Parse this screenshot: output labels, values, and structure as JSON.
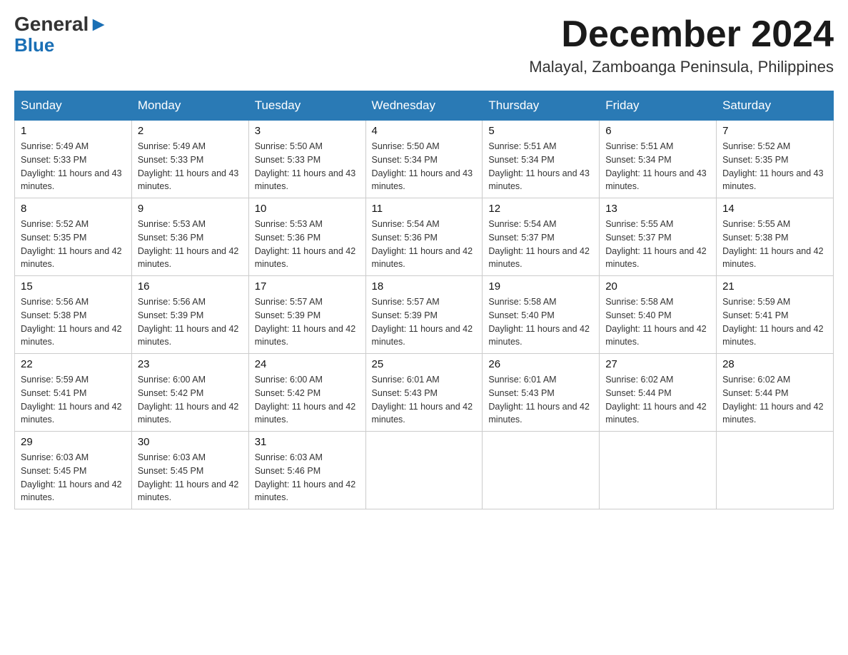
{
  "header": {
    "logo_general": "General",
    "logo_blue": "Blue",
    "month_title": "December 2024",
    "location": "Malayal, Zamboanga Peninsula, Philippines"
  },
  "weekdays": [
    "Sunday",
    "Monday",
    "Tuesday",
    "Wednesday",
    "Thursday",
    "Friday",
    "Saturday"
  ],
  "weeks": [
    [
      {
        "day": "1",
        "sunrise": "5:49 AM",
        "sunset": "5:33 PM",
        "daylight": "11 hours and 43 minutes."
      },
      {
        "day": "2",
        "sunrise": "5:49 AM",
        "sunset": "5:33 PM",
        "daylight": "11 hours and 43 minutes."
      },
      {
        "day": "3",
        "sunrise": "5:50 AM",
        "sunset": "5:33 PM",
        "daylight": "11 hours and 43 minutes."
      },
      {
        "day": "4",
        "sunrise": "5:50 AM",
        "sunset": "5:34 PM",
        "daylight": "11 hours and 43 minutes."
      },
      {
        "day": "5",
        "sunrise": "5:51 AM",
        "sunset": "5:34 PM",
        "daylight": "11 hours and 43 minutes."
      },
      {
        "day": "6",
        "sunrise": "5:51 AM",
        "sunset": "5:34 PM",
        "daylight": "11 hours and 43 minutes."
      },
      {
        "day": "7",
        "sunrise": "5:52 AM",
        "sunset": "5:35 PM",
        "daylight": "11 hours and 43 minutes."
      }
    ],
    [
      {
        "day": "8",
        "sunrise": "5:52 AM",
        "sunset": "5:35 PM",
        "daylight": "11 hours and 42 minutes."
      },
      {
        "day": "9",
        "sunrise": "5:53 AM",
        "sunset": "5:36 PM",
        "daylight": "11 hours and 42 minutes."
      },
      {
        "day": "10",
        "sunrise": "5:53 AM",
        "sunset": "5:36 PM",
        "daylight": "11 hours and 42 minutes."
      },
      {
        "day": "11",
        "sunrise": "5:54 AM",
        "sunset": "5:36 PM",
        "daylight": "11 hours and 42 minutes."
      },
      {
        "day": "12",
        "sunrise": "5:54 AM",
        "sunset": "5:37 PM",
        "daylight": "11 hours and 42 minutes."
      },
      {
        "day": "13",
        "sunrise": "5:55 AM",
        "sunset": "5:37 PM",
        "daylight": "11 hours and 42 minutes."
      },
      {
        "day": "14",
        "sunrise": "5:55 AM",
        "sunset": "5:38 PM",
        "daylight": "11 hours and 42 minutes."
      }
    ],
    [
      {
        "day": "15",
        "sunrise": "5:56 AM",
        "sunset": "5:38 PM",
        "daylight": "11 hours and 42 minutes."
      },
      {
        "day": "16",
        "sunrise": "5:56 AM",
        "sunset": "5:39 PM",
        "daylight": "11 hours and 42 minutes."
      },
      {
        "day": "17",
        "sunrise": "5:57 AM",
        "sunset": "5:39 PM",
        "daylight": "11 hours and 42 minutes."
      },
      {
        "day": "18",
        "sunrise": "5:57 AM",
        "sunset": "5:39 PM",
        "daylight": "11 hours and 42 minutes."
      },
      {
        "day": "19",
        "sunrise": "5:58 AM",
        "sunset": "5:40 PM",
        "daylight": "11 hours and 42 minutes."
      },
      {
        "day": "20",
        "sunrise": "5:58 AM",
        "sunset": "5:40 PM",
        "daylight": "11 hours and 42 minutes."
      },
      {
        "day": "21",
        "sunrise": "5:59 AM",
        "sunset": "5:41 PM",
        "daylight": "11 hours and 42 minutes."
      }
    ],
    [
      {
        "day": "22",
        "sunrise": "5:59 AM",
        "sunset": "5:41 PM",
        "daylight": "11 hours and 42 minutes."
      },
      {
        "day": "23",
        "sunrise": "6:00 AM",
        "sunset": "5:42 PM",
        "daylight": "11 hours and 42 minutes."
      },
      {
        "day": "24",
        "sunrise": "6:00 AM",
        "sunset": "5:42 PM",
        "daylight": "11 hours and 42 minutes."
      },
      {
        "day": "25",
        "sunrise": "6:01 AM",
        "sunset": "5:43 PM",
        "daylight": "11 hours and 42 minutes."
      },
      {
        "day": "26",
        "sunrise": "6:01 AM",
        "sunset": "5:43 PM",
        "daylight": "11 hours and 42 minutes."
      },
      {
        "day": "27",
        "sunrise": "6:02 AM",
        "sunset": "5:44 PM",
        "daylight": "11 hours and 42 minutes."
      },
      {
        "day": "28",
        "sunrise": "6:02 AM",
        "sunset": "5:44 PM",
        "daylight": "11 hours and 42 minutes."
      }
    ],
    [
      {
        "day": "29",
        "sunrise": "6:03 AM",
        "sunset": "5:45 PM",
        "daylight": "11 hours and 42 minutes."
      },
      {
        "day": "30",
        "sunrise": "6:03 AM",
        "sunset": "5:45 PM",
        "daylight": "11 hours and 42 minutes."
      },
      {
        "day": "31",
        "sunrise": "6:03 AM",
        "sunset": "5:46 PM",
        "daylight": "11 hours and 42 minutes."
      },
      null,
      null,
      null,
      null
    ]
  ]
}
